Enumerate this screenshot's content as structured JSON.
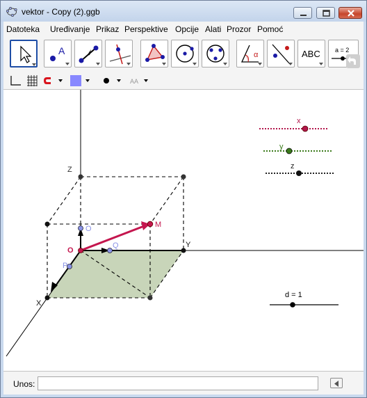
{
  "window": {
    "title": "vektor - Copy (2).ggb"
  },
  "menu": [
    "Datoteka",
    "Uređivanje",
    "Prikaz",
    "Perspektive",
    "Opcije",
    "Alati",
    "Prozor",
    "Pomoć"
  ],
  "toolbar": {
    "tools": [
      "move-tool",
      "point-tool",
      "vector-tool",
      "perpendicular-line-tool",
      "polygon-tool",
      "circle-tool",
      "conic-tool",
      "angle-tool",
      "reflect-tool",
      "text-tool",
      "slider-tool",
      "undo-redo-tool"
    ],
    "text_tool_label": "ABC",
    "slider_tool_label": "a = 2"
  },
  "stylebar": {
    "color": "#8888ff",
    "label_icon": "AA"
  },
  "graphics": {
    "labels": {
      "z_axis": "Z",
      "y_axis": "Y",
      "x_axis": "X",
      "origin": "O",
      "point_o": "O",
      "point_q": "Q",
      "point_p": "P",
      "point_m": "M"
    },
    "sliders": {
      "x": {
        "label": "x",
        "color": "#b2164b"
      },
      "y": {
        "label": "y",
        "color": "#3a7a1a"
      },
      "z": {
        "label": "z",
        "color": "#222222"
      },
      "d": {
        "label": "d = 1",
        "color": "#000000"
      }
    },
    "colors": {
      "vector": "#c4164e",
      "plane_fill": "#c8d5b9",
      "point_blue": "#8a93e6"
    }
  },
  "input_bar": {
    "label": "Unos:",
    "value": ""
  }
}
